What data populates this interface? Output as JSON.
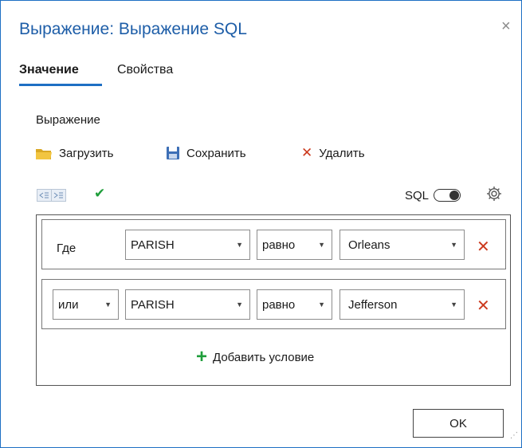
{
  "dialog": {
    "title": "Выражение: Выражение SQL",
    "close_glyph": "×"
  },
  "tabs": [
    {
      "label": "Значение",
      "active": true
    },
    {
      "label": "Свойства",
      "active": false
    }
  ],
  "section_label": "Выражение",
  "toolbar": {
    "load_label": "Загрузить",
    "save_label": "Сохранить",
    "delete_label": "Удалить",
    "load_icon": "folder-icon",
    "save_icon": "floppy-disk-icon",
    "delete_icon": "close-x-icon"
  },
  "sql_toggle": {
    "label": "SQL",
    "on": false
  },
  "clauses": [
    {
      "connector": "Где",
      "field": "PARISH",
      "operator": "равно",
      "value": "Orleans"
    },
    {
      "connector": "или",
      "field": "PARISH",
      "operator": "равно",
      "value": "Jefferson"
    }
  ],
  "add_condition_label": "Добавить условие",
  "ok_label": "OK",
  "colors": {
    "title": "#1e5ea8",
    "accent": "#1e6fc4",
    "delete_red": "#cc3a1e",
    "check_green": "#1f9e3b"
  }
}
